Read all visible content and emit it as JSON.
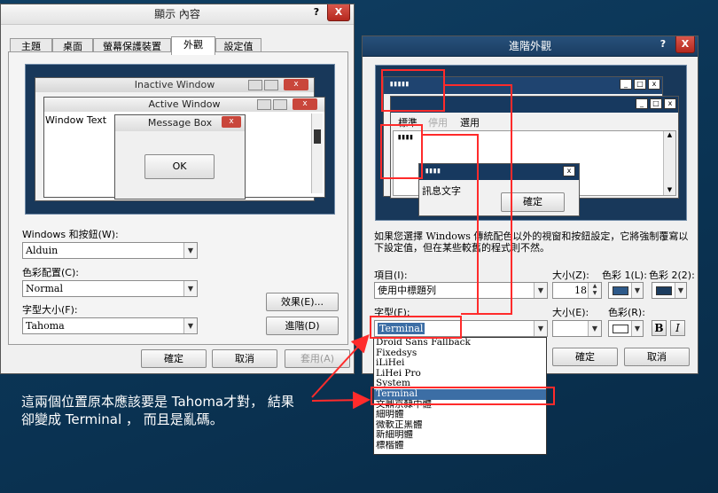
{
  "display_props": {
    "title": "顯示 內容",
    "help_glyph": "?",
    "close_glyph": "X",
    "tabs": [
      "主題",
      "桌面",
      "螢幕保護裝置",
      "外觀",
      "設定值"
    ],
    "preview": {
      "inactive_title": "Inactive Window",
      "active_title": "Active Window",
      "window_text": "Window Text",
      "msgbox_title": "Message Box",
      "ok": "OK"
    },
    "windows_buttons_label": "Windows 和按鈕(W):",
    "windows_buttons_value": "Alduin",
    "color_scheme_label": "色彩配置(C):",
    "color_scheme_value": "Normal",
    "font_size_label": "字型大小(F):",
    "font_size_value": "Tahoma",
    "effects_btn": "效果(E)...",
    "advanced_btn": "進階(D)",
    "ok": "確定",
    "cancel": "取消",
    "apply": "套用(A)"
  },
  "advanced": {
    "title": "進階外觀",
    "help_glyph": "?",
    "close_glyph": "X",
    "preview": {
      "title_dots": "▮▮▮▮▮",
      "menu_normal": "標準",
      "menu_disabled": "停用",
      "menu_selected": "選用",
      "text_dots": "▮▮▮▮",
      "msg_dots": "▮▮▮▮",
      "msg_text": "訊息文字",
      "msg_ok": "確定"
    },
    "description": "如果您選擇 Windows 傳統配色以外的視窗和按鈕設定，它將強制覆寫以下設定值，但在某些較舊的程式則不然。",
    "item_label": "項目(I):",
    "item_value": "使用中標題列",
    "size_label": "大小(Z):",
    "size_value": "18",
    "color1_label": "色彩 1(L):",
    "color2_label": "色彩 2(2):",
    "font_label": "字型(F):",
    "font_value": "Terminal",
    "font_size_label": "大小(E):",
    "font_color_label": "色彩(R):",
    "bold": "B",
    "italic": "I",
    "ok": "確定",
    "cancel": "取消",
    "font_list": [
      "Droid Sans Fallback",
      "Fixedsys",
      "iLiHei",
      "LiHei Pro",
      "System",
      "Terminal",
      "文鼎京隸中體",
      "細明體",
      "微軟正黑體",
      "新細明體",
      "標楷體"
    ],
    "font_list_selected": "Terminal"
  },
  "annotation": {
    "line1": "這兩個位置原本應該要是 Tahoma才對， 結果",
    "line2": "卻變成 Terminal ， 而且是亂碼。"
  },
  "colors": {
    "desktop": "#0b3556",
    "annotation_red": "#ff2b2b",
    "selection": "#3c6ea5",
    "swatch1": "#2e5a8a",
    "swatch2": "#1d3d5f"
  }
}
